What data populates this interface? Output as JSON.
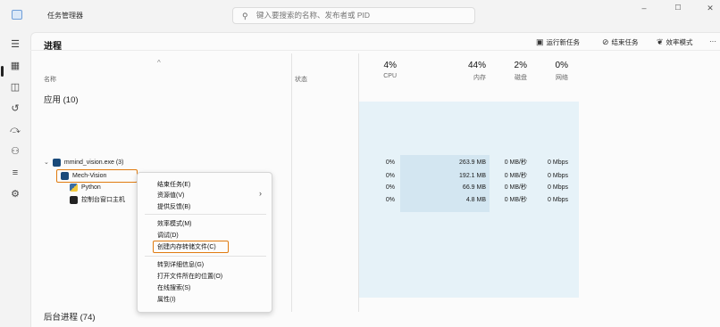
{
  "window": {
    "title": "任务管理器",
    "search_placeholder": "键入要搜索的名称、发布者或 PID",
    "controls": [
      "–",
      "☐",
      "✕"
    ]
  },
  "nav": {
    "items": [
      {
        "name": "menu-icon",
        "glyph": "☰"
      },
      {
        "name": "processes-icon",
        "glyph": "▦"
      },
      {
        "name": "performance-icon",
        "glyph": "◫"
      },
      {
        "name": "app-history-icon",
        "glyph": "↺"
      },
      {
        "name": "startup-apps-icon",
        "glyph": "⤼"
      },
      {
        "name": "users-icon",
        "glyph": "⚇"
      },
      {
        "name": "details-icon",
        "glyph": "≡"
      },
      {
        "name": "services-icon",
        "glyph": "⚙"
      }
    ]
  },
  "toolbar": {
    "page_title": "进程",
    "run_new_task": "运行新任务",
    "end_task": "结束任务",
    "efficiency_mode": "效率模式",
    "more": "···"
  },
  "columns": {
    "name": "名称",
    "status": "状态",
    "cpu_pct": "4%",
    "cpu_label": "CPU",
    "mem_pct": "44%",
    "mem_label": "内存",
    "disk_pct": "2%",
    "disk_label": "磁盘",
    "net_pct": "0%",
    "net_label": "网络"
  },
  "groups": {
    "apps": "应用 (10)",
    "background": "后台进程 (74)"
  },
  "process": {
    "name": "mmind_vision.exe (3)",
    "cpu": "0%",
    "mem": "263.9 MB",
    "disk": "0 MB/秒",
    "net": "0 Mbps",
    "children": [
      {
        "name": "Mech-Vision",
        "cpu": "0%",
        "mem": "192.1 MB",
        "disk": "0 MB/秒",
        "net": "0 Mbps"
      },
      {
        "name": "Python",
        "cpu": "0%",
        "mem": "66.9 MB",
        "disk": "0 MB/秒",
        "net": "0 Mbps"
      },
      {
        "name": "控制台窗口主机",
        "cpu": "0%",
        "mem": "4.8 MB",
        "disk": "0 MB/秒",
        "net": "0 Mbps"
      }
    ]
  },
  "context_menu": {
    "items": [
      "结束任务(E)",
      "资源值(V)",
      "提供反馈(B)",
      "效率模式(M)",
      "调试(D)",
      "创建内存转储文件(C)",
      "转到详细信息(G)",
      "打开文件所在的位置(O)",
      "在线搜索(S)",
      "属性(I)"
    ],
    "submenu_arrow": "›"
  },
  "colors": {
    "highlight": "#e07b10",
    "tint": "#e6f2f8",
    "tint_mem": "#d3e6f1"
  }
}
